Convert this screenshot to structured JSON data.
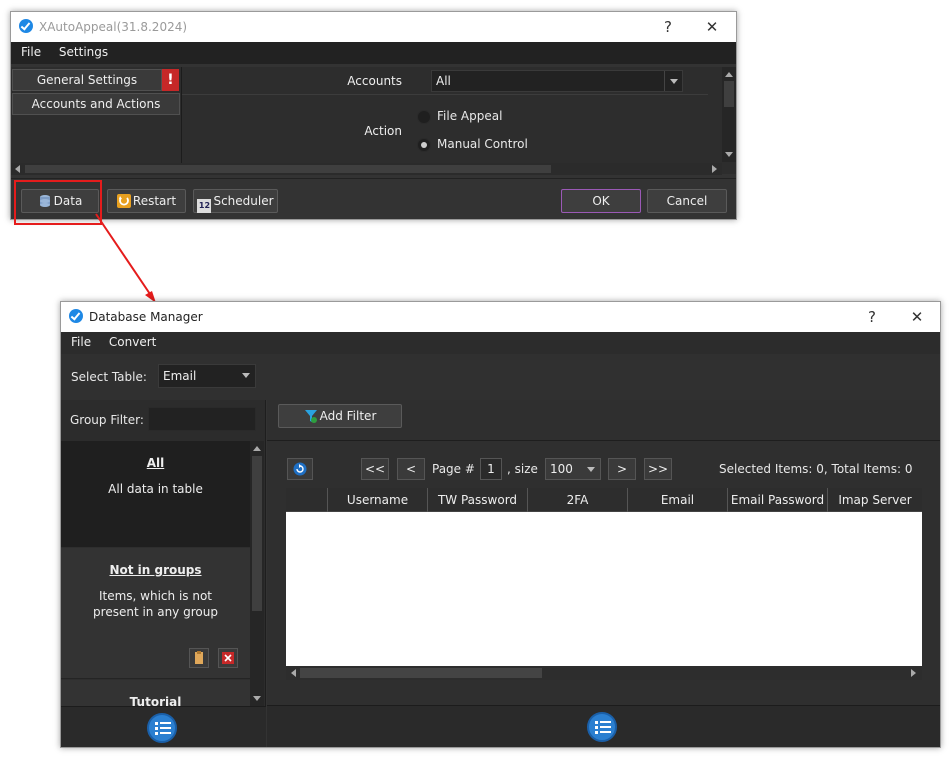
{
  "window1": {
    "title": "XAutoAppeal(31.8.2024)",
    "help_glyph": "?",
    "close_glyph": "✕",
    "menu": [
      "File",
      "Settings"
    ],
    "nav": {
      "general_settings": "General Settings",
      "general_settings_alert": "!",
      "accounts_and_actions": "Accounts and Actions"
    },
    "accounts_label": "Accounts",
    "accounts_value": "All",
    "action_label": "Action",
    "action_options": [
      "File Appeal",
      "Manual Control"
    ],
    "action_selected": "Manual Control",
    "footer": {
      "data_button": "Data",
      "restart_button": "Restart",
      "scheduler_button": "Scheduler",
      "scheduler_icon_text": "12",
      "ok_button": "OK",
      "cancel_button": "Cancel"
    },
    "colors": {
      "alert": "#c62828",
      "ok_border": "#9b59b6",
      "highlight": "#e51c1c"
    }
  },
  "window2": {
    "title": "Database Manager",
    "help_glyph": "?",
    "close_glyph": "✕",
    "menu": [
      "File",
      "Convert"
    ],
    "select_table_label": "Select Table:",
    "select_table_value": "Email",
    "group_filter_label": "Group Filter:",
    "group_filter_value": "",
    "add_filter_button": "Add Filter",
    "groups": [
      {
        "title": "All",
        "description": "All data in table"
      },
      {
        "title": "Not in groups",
        "description": "Items, which is not present in any group"
      },
      {
        "title": "Tutorial",
        "description": ""
      }
    ],
    "pager": {
      "first": "<<",
      "prev": "<",
      "page_label": "Page #",
      "page_value": "1",
      "size_label": ", size",
      "size_value": "100",
      "next": ">",
      "last": ">>",
      "selected_label": "Selected Items:",
      "selected_value": "0",
      "total_label": ", Total Items:",
      "total_value": "0"
    },
    "columns": [
      "",
      "Username",
      "TW Password",
      "2FA",
      "Email",
      "Email Password",
      "Imap Server"
    ],
    "colors": {
      "accent_blue": "#2b7fd0"
    }
  }
}
